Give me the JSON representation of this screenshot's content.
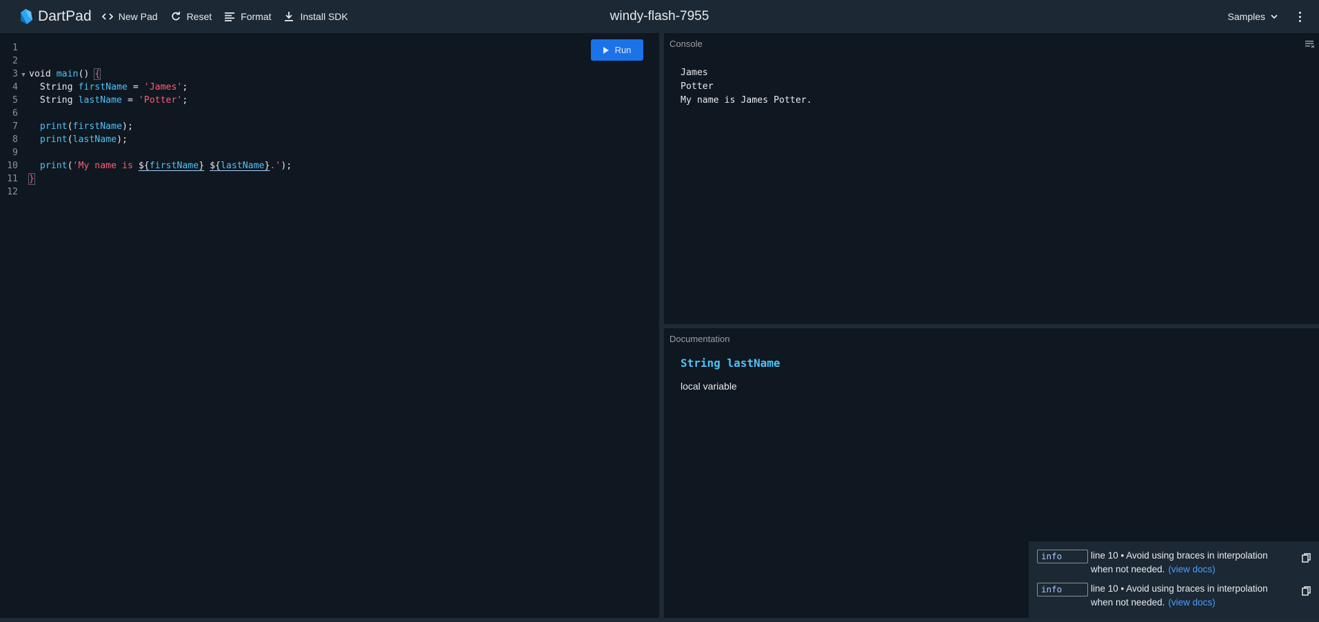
{
  "header": {
    "brand": "DartPad",
    "buttons": {
      "new_pad": "New Pad",
      "reset": "Reset",
      "format": "Format",
      "install_sdk": "Install SDK"
    },
    "pad_title": "windy-flash-7955",
    "samples": "Samples"
  },
  "editor": {
    "run_label": "Run",
    "line_numbers": [
      "1",
      "2",
      "3",
      "4",
      "5",
      "6",
      "7",
      "8",
      "9",
      "10",
      "11",
      "12"
    ],
    "code": {
      "l3": {
        "kw": "void",
        "fn": "main",
        "paren": "()"
      },
      "l4": {
        "type": "String",
        "name": "firstName",
        "eq": " = ",
        "str": "'James'",
        "end": ";"
      },
      "l5": {
        "type": "String",
        "name": "lastName",
        "eq": " = ",
        "str": "'Potter'",
        "end": ";"
      },
      "l7": {
        "fn": "print",
        "open": "(",
        "arg": "firstName",
        "close": ");"
      },
      "l8": {
        "fn": "print",
        "open": "(",
        "arg": "lastName",
        "close": ");"
      },
      "l10": {
        "fn": "print",
        "open": "(",
        "str_start": "'My name is ",
        "interp1_open": "${",
        "interp1": "firstName",
        "interp1_close": "}",
        "space": " ",
        "interp2_open": "${",
        "interp2": "lastName",
        "interp2_close": "}",
        "str_end": ".'",
        "close": ");"
      },
      "open_brace": "{",
      "close_brace": "}"
    }
  },
  "console": {
    "label": "Console",
    "lines": [
      "James",
      "Potter",
      "My name is James Potter."
    ]
  },
  "documentation": {
    "label": "Documentation",
    "title": "String lastName",
    "body": "local variable"
  },
  "issues": [
    {
      "badge": "info",
      "message": "line 10 • Avoid using braces in interpolation when not needed.",
      "link": "(view docs)"
    },
    {
      "badge": "info",
      "message": "line 10 • Avoid using braces in interpolation when not needed.",
      "link": "(view docs)"
    }
  ],
  "colors": {
    "topbar": "#1c2834",
    "editor_bg": "#0f1720",
    "accent": "#1a73e8",
    "identifier": "#4fc3f7",
    "string": "#ff5c7a"
  }
}
